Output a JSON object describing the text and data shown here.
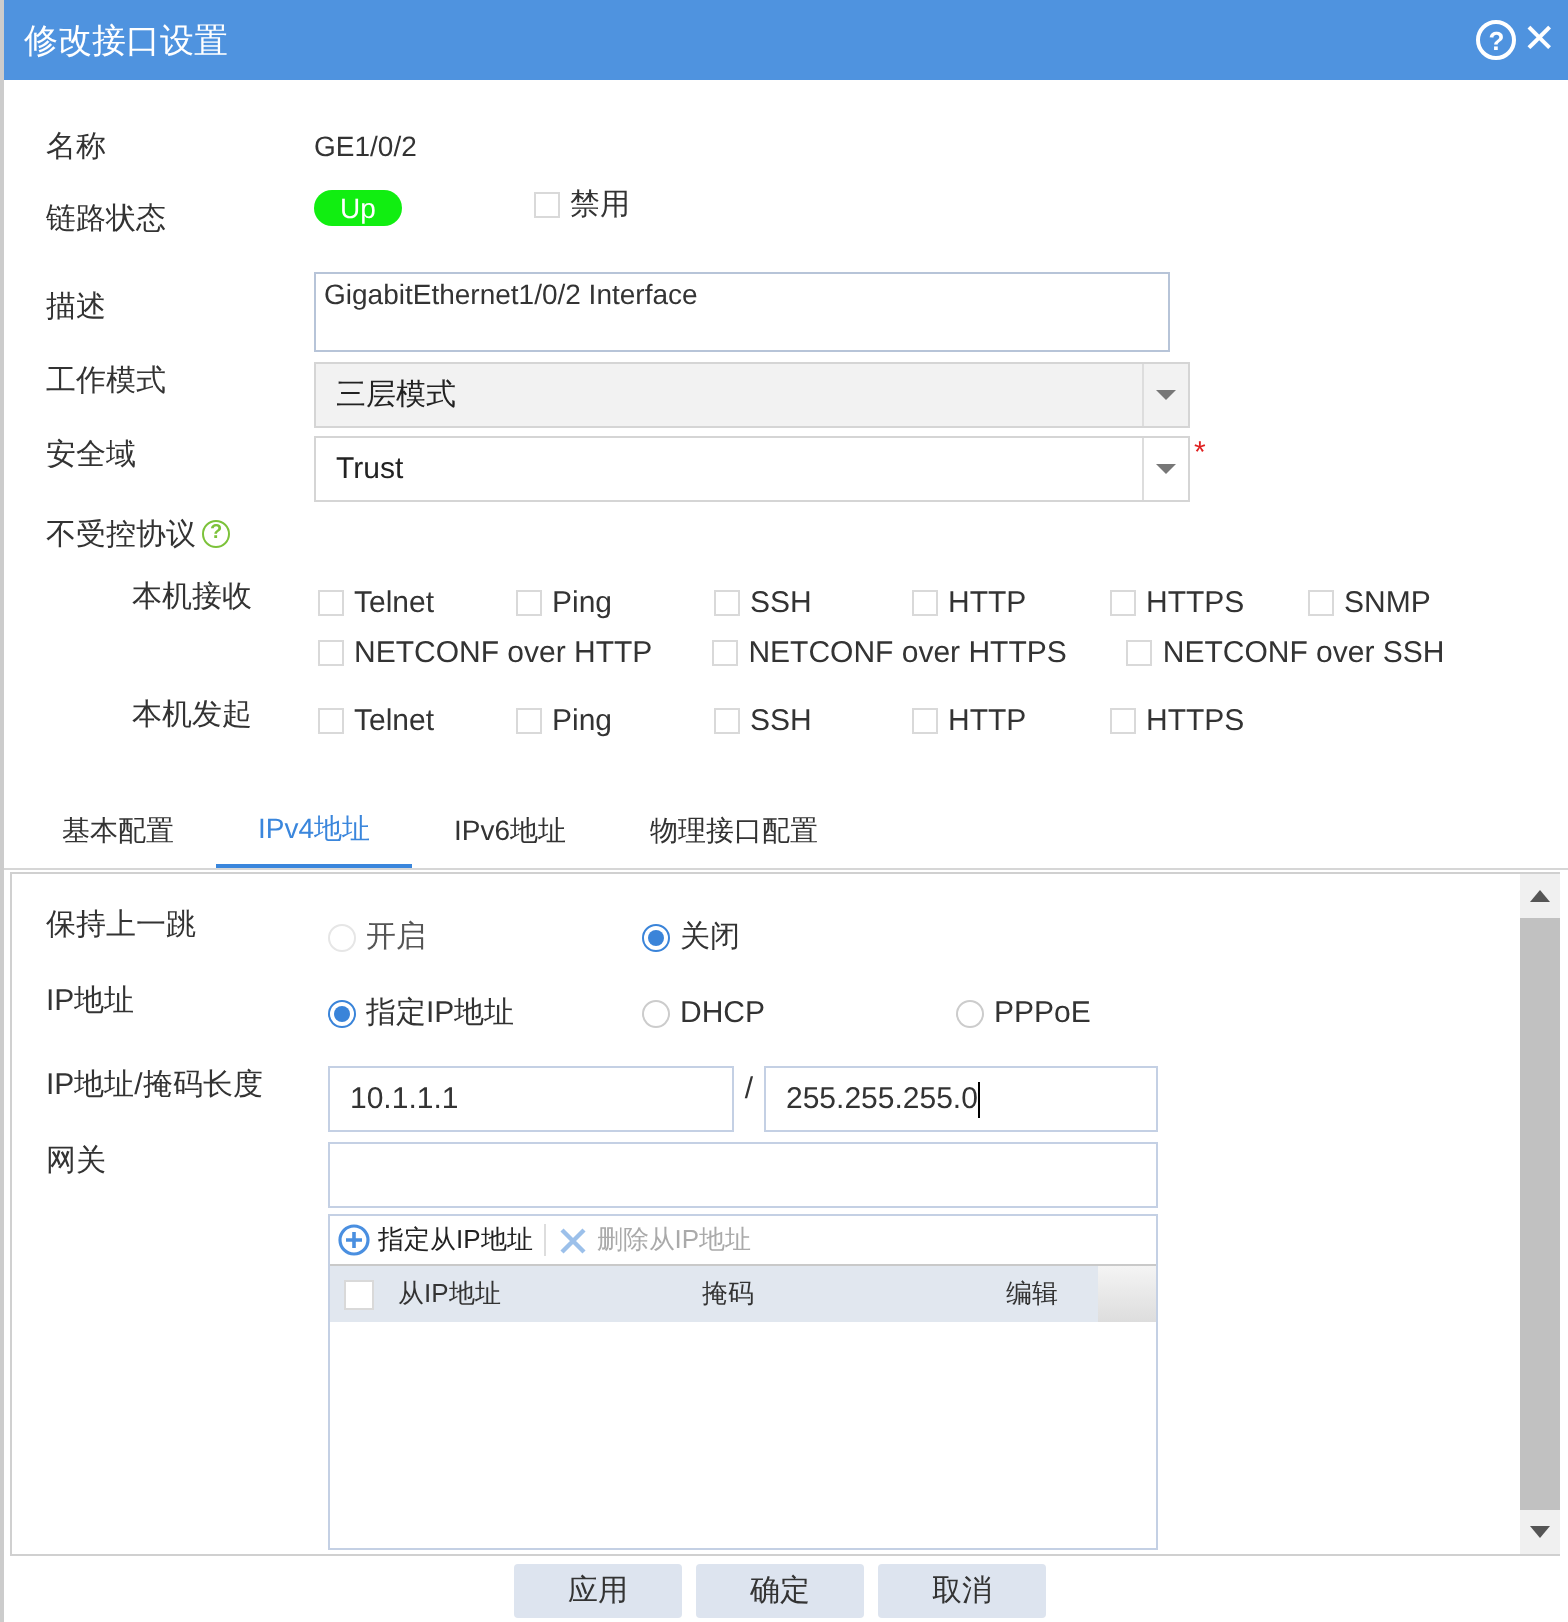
{
  "title": "修改接口设置",
  "title_help": "?",
  "title_close": "✕",
  "name": {
    "label": "名称",
    "value": "GE1/0/2"
  },
  "link_status": {
    "label": "链路状态",
    "status": "Up",
    "disable": {
      "label": "禁用",
      "checked": false
    }
  },
  "description": {
    "label": "描述",
    "value": "GigabitEthernet1/0/2 Interface"
  },
  "work_mode": {
    "label": "工作模式",
    "value": "三层模式"
  },
  "security_zone": {
    "label": "安全域",
    "value": "Trust",
    "required_mark": "*"
  },
  "uncontrolled_protocols": {
    "label": "不受控协议",
    "help": "?",
    "groups": [
      {
        "label": "本机接收",
        "options": [
          {
            "label": "Telnet",
            "checked": false
          },
          {
            "label": "Ping",
            "checked": false
          },
          {
            "label": "SSH",
            "checked": false
          },
          {
            "label": "HTTP",
            "checked": false
          },
          {
            "label": "HTTPS",
            "checked": false
          },
          {
            "label": "SNMP",
            "checked": false
          },
          {
            "label": "NETCONF over HTTP",
            "checked": false
          },
          {
            "label": "NETCONF over HTTPS",
            "checked": false
          },
          {
            "label": "NETCONF over SSH",
            "checked": false
          }
        ]
      },
      {
        "label": "本机发起",
        "options": [
          {
            "label": "Telnet",
            "checked": false
          },
          {
            "label": "Ping",
            "checked": false
          },
          {
            "label": "SSH",
            "checked": false
          },
          {
            "label": "HTTP",
            "checked": false
          },
          {
            "label": "HTTPS",
            "checked": false
          }
        ]
      }
    ]
  },
  "tabs": [
    {
      "label": "基本配置",
      "selected": false
    },
    {
      "label": "IPv4地址",
      "selected": true
    },
    {
      "label": "IPv6地址",
      "selected": false
    },
    {
      "label": "物理接口配置",
      "selected": false
    }
  ],
  "keep_last_hop": {
    "label": "保持上一跳",
    "options": [
      {
        "label": "开启",
        "selected": false,
        "disabled": true
      },
      {
        "label": "关闭",
        "selected": true,
        "disabled": false
      }
    ]
  },
  "ip_mode": {
    "label": "IP地址",
    "options": [
      {
        "label": "指定IP地址",
        "selected": true,
        "disabled": false
      },
      {
        "label": "DHCP",
        "selected": false,
        "disabled": false
      },
      {
        "label": "PPPoE",
        "selected": false,
        "disabled": false
      }
    ]
  },
  "ip_mask": {
    "label": "IP地址/掩码长度",
    "ip": "10.1.1.1",
    "separator": "/",
    "mask": "255.255.255.0"
  },
  "gateway": {
    "label": "网关"
  },
  "secondary_ips": {
    "toolbar": [
      {
        "label": "指定从IP地址",
        "kind": "add",
        "disabled": false
      },
      {
        "label": "删除从IP地址",
        "kind": "delete",
        "disabled": true
      }
    ],
    "select_all": {
      "checked": false
    },
    "columns": [
      "从IP地址",
      "掩码",
      "编辑"
    ]
  },
  "buttons": [
    "应用",
    "确定",
    "取消"
  ]
}
